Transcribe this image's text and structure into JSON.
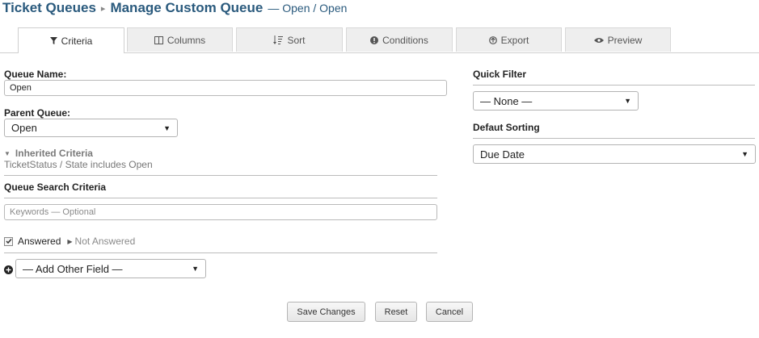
{
  "header": {
    "title": "Ticket Queues",
    "subtitle": "Manage Custom Queue",
    "context": "— Open / Open"
  },
  "tabs": [
    {
      "label": "Criteria",
      "icon": "filter-icon",
      "active": true
    },
    {
      "label": "Columns",
      "icon": "columns-icon"
    },
    {
      "label": "Sort",
      "icon": "sort-icon"
    },
    {
      "label": "Conditions",
      "icon": "info-icon"
    },
    {
      "label": "Export",
      "icon": "export-icon"
    },
    {
      "label": "Preview",
      "icon": "eye-icon"
    }
  ],
  "left": {
    "queue_name_label": "Queue Name:",
    "queue_name_value": "Open",
    "parent_queue_label": "Parent Queue:",
    "parent_queue_value": "Open",
    "inherited_label": "Inherited Criteria",
    "inherited_text": "TicketStatus / State includes Open",
    "search_heading": "Queue Search Criteria",
    "keywords_placeholder": "Keywords — Optional",
    "answered_label": "Answered",
    "answered_checked": true,
    "not_answered_label": "Not Answered",
    "add_field_value": "— Add Other Field —"
  },
  "right": {
    "quick_filter_label": "Quick Filter",
    "quick_filter_value": "— None —",
    "default_sorting_label": "Defaut Sorting",
    "default_sorting_value": "Due Date"
  },
  "footer": {
    "save": "Save Changes",
    "reset": "Reset",
    "cancel": "Cancel"
  }
}
